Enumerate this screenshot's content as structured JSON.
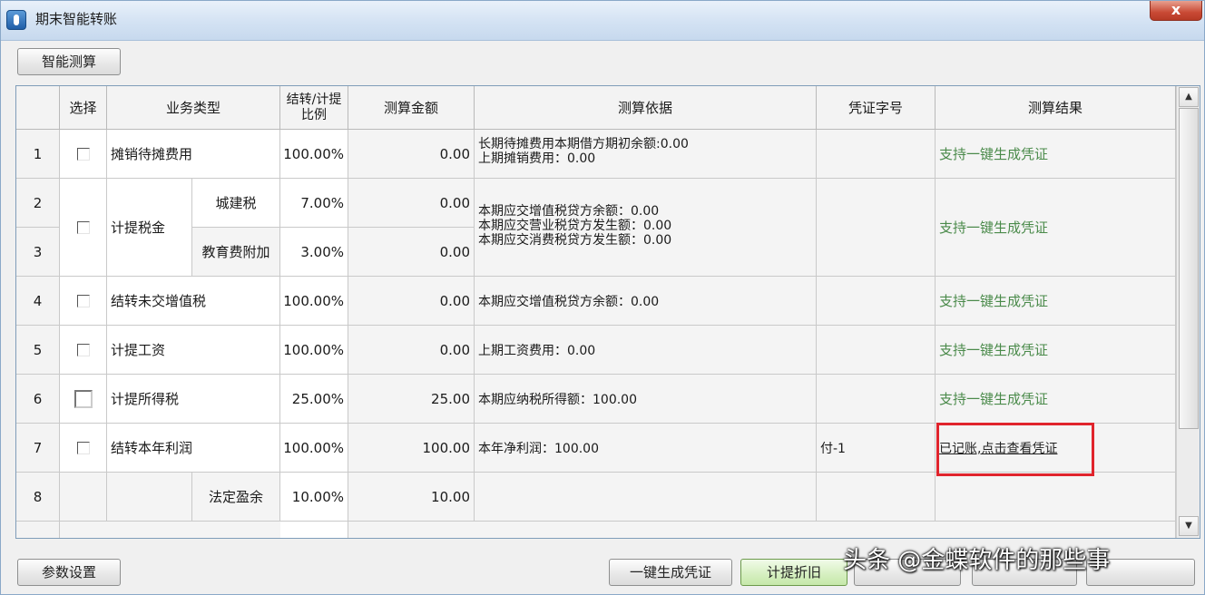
{
  "window": {
    "title": "期末智能转账",
    "close_label": "x"
  },
  "toolbar": {
    "calc_button": "智能测算"
  },
  "table": {
    "headers": [
      "",
      "选择",
      "业务类型",
      "结转/计提比例",
      "测算金额",
      "测算依据",
      "凭证字号",
      "测算结果"
    ],
    "rows": [
      {
        "num": "1",
        "type": "摊销待摊费用",
        "ratio": "100.00%",
        "amount": "0.00",
        "basis": [
          "长期待摊费用本期借方期初余额:0.00",
          "上期摊销费用：0.00"
        ],
        "voucher": "",
        "result": "支持一键生成凭证"
      },
      {
        "num": "2",
        "type": "计提税金",
        "sub": "城建税",
        "ratio": "7.00%",
        "amount": "0.00",
        "basis": [
          "本期应交增值税贷方余额：0.00",
          "本期应交营业税贷方发生额：0.00",
          "本期应交消费税贷方发生额：0.00"
        ],
        "voucher": "",
        "result": "支持一键生成凭证"
      },
      {
        "num": "3",
        "sub": "教育费附加",
        "ratio": "3.00%",
        "amount": "0.00"
      },
      {
        "num": "4",
        "type": "结转未交增值税",
        "ratio": "100.00%",
        "amount": "0.00",
        "basis": [
          "本期应交增值税贷方余额：0.00"
        ],
        "voucher": "",
        "result": "支持一键生成凭证"
      },
      {
        "num": "5",
        "type": "计提工资",
        "ratio": "100.00%",
        "amount": "0.00",
        "basis": [
          "上期工资费用：0.00"
        ],
        "voucher": "",
        "result": "支持一键生成凭证"
      },
      {
        "num": "6",
        "type": "计提所得税",
        "ratio": "25.00%",
        "amount": "25.00",
        "basis": [
          "本期应纳税所得额：100.00"
        ],
        "voucher": "",
        "result": "支持一键生成凭证"
      },
      {
        "num": "7",
        "type": "结转本年利润",
        "ratio": "100.00%",
        "amount": "100.00",
        "basis": [
          "本年净利润：100.00"
        ],
        "voucher": "付-1",
        "result": "已记账,点击查看凭证"
      },
      {
        "num": "8",
        "sub": "法定盈余",
        "ratio": "10.00%",
        "amount": "10.00"
      }
    ]
  },
  "footer": {
    "params_button": "参数设置",
    "generate_button": "一键生成凭证",
    "depreciation_button": "计提折旧"
  },
  "watermark": "头条 @金蝶软件的那些事",
  "colors": {
    "link_green": "#4a8a4a",
    "highlight_red": "#e0242c",
    "accent_green": "#c6e8aa"
  }
}
